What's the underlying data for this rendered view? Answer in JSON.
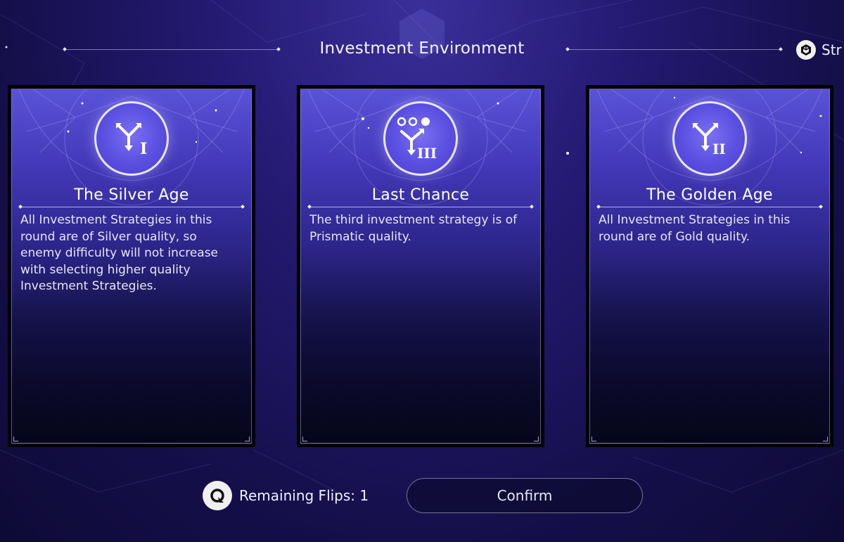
{
  "header": {
    "title": "Investment Environment",
    "top_right_label": "Str",
    "top_right_icon": "cube-icon"
  },
  "cards": [
    {
      "title": "The Silver Age",
      "icon": "branch-arrows-tier-i-icon",
      "tier": "I",
      "description": "All Investment Strategies in this round are of Silver quality, so enemy difficulty will not increase with selecting higher quality Investment Strategies."
    },
    {
      "title": "Last Chance",
      "icon": "branch-arrows-tier-iii-icon",
      "tier": "III",
      "description": "The third investment strategy is of Prismatic quality."
    },
    {
      "title": "The Golden Age",
      "icon": "branch-arrows-tier-ii-icon",
      "tier": "II",
      "description": "All Investment Strategies in this round are of Gold quality."
    }
  ],
  "footer": {
    "flips_label": "Remaining Flips: 1",
    "confirm_label": "Confirm"
  },
  "colors": {
    "background": "#1c1560",
    "card_top": "#5a52d8",
    "emblem": "#5a4fe0"
  }
}
